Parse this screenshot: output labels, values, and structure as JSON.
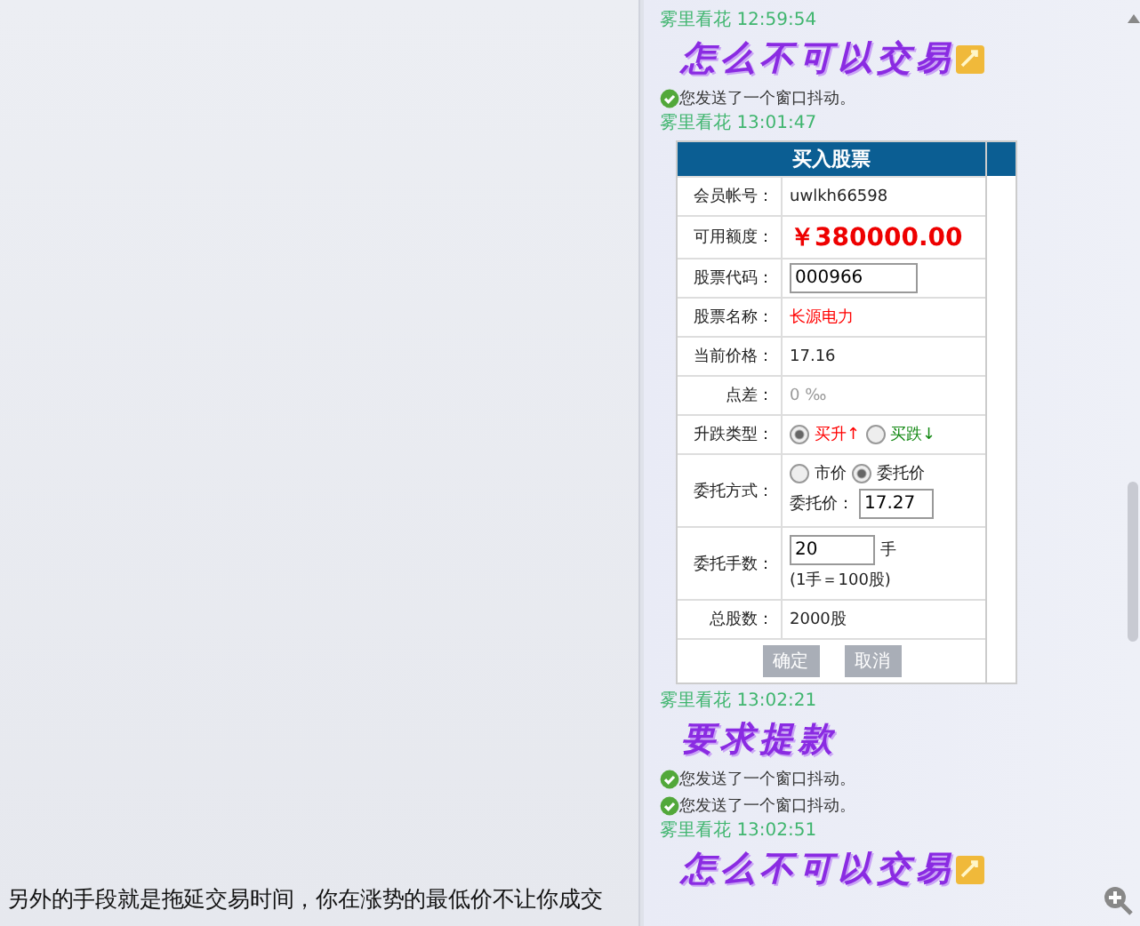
{
  "left_pane": {
    "caption": "另外的手段就是拖延交易时间，你在涨势的最低价不让你成交"
  },
  "chat": {
    "items": [
      {
        "kind": "header",
        "sender": "雾里看花",
        "time": "12:59:54"
      },
      {
        "kind": "big_text",
        "text": "怎么不可以交易",
        "sticker": true
      },
      {
        "kind": "notice",
        "text": "您发送了一个窗口抖动。"
      },
      {
        "kind": "header",
        "sender": "雾里看花",
        "time": "13:01:47"
      },
      {
        "kind": "form",
        "title": "买入股票",
        "rows": [
          {
            "kind": "text",
            "label": "会员帐号：",
            "value": "uwlkh66598",
            "color": "#222222"
          },
          {
            "kind": "amount",
            "label": "可用额度：",
            "value": "￥380000.00"
          },
          {
            "kind": "input",
            "label": "股票代码：",
            "value": "000966"
          },
          {
            "kind": "text",
            "label": "股票名称：",
            "value": "长源电力",
            "color": "#ff0000"
          },
          {
            "kind": "text",
            "label": "当前价格：",
            "value": "17.16",
            "color": "#222222"
          },
          {
            "kind": "text",
            "label": "点差：",
            "value": "0 ‰",
            "color": "#999999"
          },
          {
            "kind": "radio",
            "label": "升跌类型：",
            "options": [
              {
                "label": "买升↑",
                "selected": true,
                "color": "#ff0000"
              },
              {
                "label": "买跌↓",
                "selected": false,
                "color": "#118811"
              }
            ]
          },
          {
            "kind": "method",
            "label": "委托方式：",
            "options": [
              {
                "label": "市价",
                "selected": false,
                "color": "#222222"
              },
              {
                "label": "委托价",
                "selected": true,
                "color": "#222222"
              }
            ],
            "sub_label": "委托价：",
            "value": "17.27"
          },
          {
            "kind": "quantity",
            "label": "委托手数：",
            "value": "20",
            "unit": "手",
            "note": "(1手＝100股)"
          },
          {
            "kind": "text",
            "label": "总股数：",
            "value": "2000股",
            "color": "#222222"
          }
        ],
        "buttons": [
          "确定",
          "取消"
        ]
      },
      {
        "kind": "header",
        "sender": "雾里看花",
        "time": "13:02:21"
      },
      {
        "kind": "big_text",
        "text": "要求提款",
        "sticker": false
      },
      {
        "kind": "notice",
        "text": "您发送了一个窗口抖动。"
      },
      {
        "kind": "notice",
        "text": "您发送了一个窗口抖动。"
      },
      {
        "kind": "header",
        "sender": "雾里看花",
        "time": "13:02:51"
      },
      {
        "kind": "big_text",
        "text": "怎么不可以交易",
        "sticker": true
      }
    ]
  }
}
